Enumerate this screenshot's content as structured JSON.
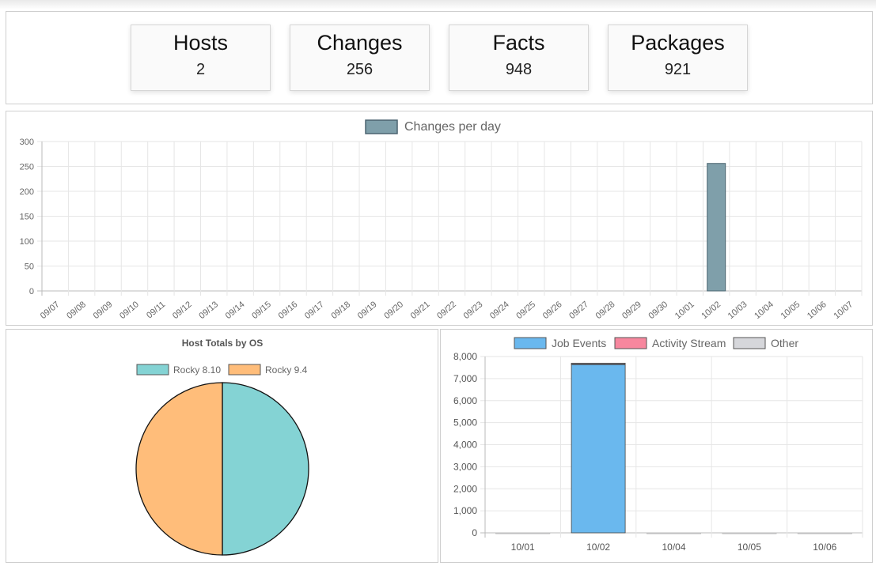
{
  "stats": [
    {
      "label": "Hosts",
      "value": "2"
    },
    {
      "label": "Changes",
      "value": "256"
    },
    {
      "label": "Facts",
      "value": "948"
    },
    {
      "label": "Packages",
      "value": "921"
    }
  ],
  "colors": {
    "changes_bar": "#7f9faa",
    "changes_bar_border": "#4b6470",
    "rocky_810": "#84d3d4",
    "rocky_94": "#ffbd7a",
    "job_events": "#6ab8ee",
    "activity_stream": "#f7879e",
    "other": "#d6d7db",
    "grid": "#e6e6e6"
  },
  "chart_data": [
    {
      "type": "bar",
      "legend": "Changes per day",
      "categories": [
        "09/07",
        "09/08",
        "09/09",
        "09/10",
        "09/11",
        "09/12",
        "09/13",
        "09/14",
        "09/15",
        "09/16",
        "09/17",
        "09/18",
        "09/19",
        "09/20",
        "09/21",
        "09/22",
        "09/23",
        "09/24",
        "09/25",
        "09/26",
        "09/27",
        "09/28",
        "09/29",
        "09/30",
        "10/01",
        "10/02",
        "10/03",
        "10/04",
        "10/05",
        "10/06",
        "10/07"
      ],
      "values": [
        0,
        0,
        0,
        0,
        0,
        0,
        0,
        0,
        0,
        0,
        0,
        0,
        0,
        0,
        0,
        0,
        0,
        0,
        0,
        0,
        0,
        0,
        0,
        0,
        0,
        256,
        0,
        0,
        0,
        0,
        0
      ],
      "ylim": [
        0,
        300
      ],
      "yticks": [
        "0",
        "50",
        "100",
        "150",
        "200",
        "250",
        "300"
      ],
      "grid": true,
      "legend_position": "top"
    },
    {
      "type": "pie",
      "title": "Host Totals by OS",
      "labels": [
        "Rocky 8.10",
        "Rocky 9.4"
      ],
      "values": [
        1,
        1
      ],
      "legend_position": "top"
    },
    {
      "type": "bar",
      "stacked": true,
      "categories": [
        "10/01",
        "10/02",
        "10/04",
        "10/05",
        "10/06"
      ],
      "series": [
        {
          "name": "Job Events",
          "values": [
            0,
            7650,
            0,
            0,
            0
          ]
        },
        {
          "name": "Activity Stream",
          "values": [
            0,
            20,
            0,
            0,
            0
          ]
        },
        {
          "name": "Other",
          "values": [
            0,
            30,
            0,
            0,
            0
          ]
        }
      ],
      "ylim": [
        0,
        8000
      ],
      "yticks": [
        "0",
        "1,000",
        "2,000",
        "3,000",
        "4,000",
        "5,000",
        "6,000",
        "7,000",
        "8,000"
      ],
      "grid": true,
      "legend_position": "top"
    }
  ]
}
